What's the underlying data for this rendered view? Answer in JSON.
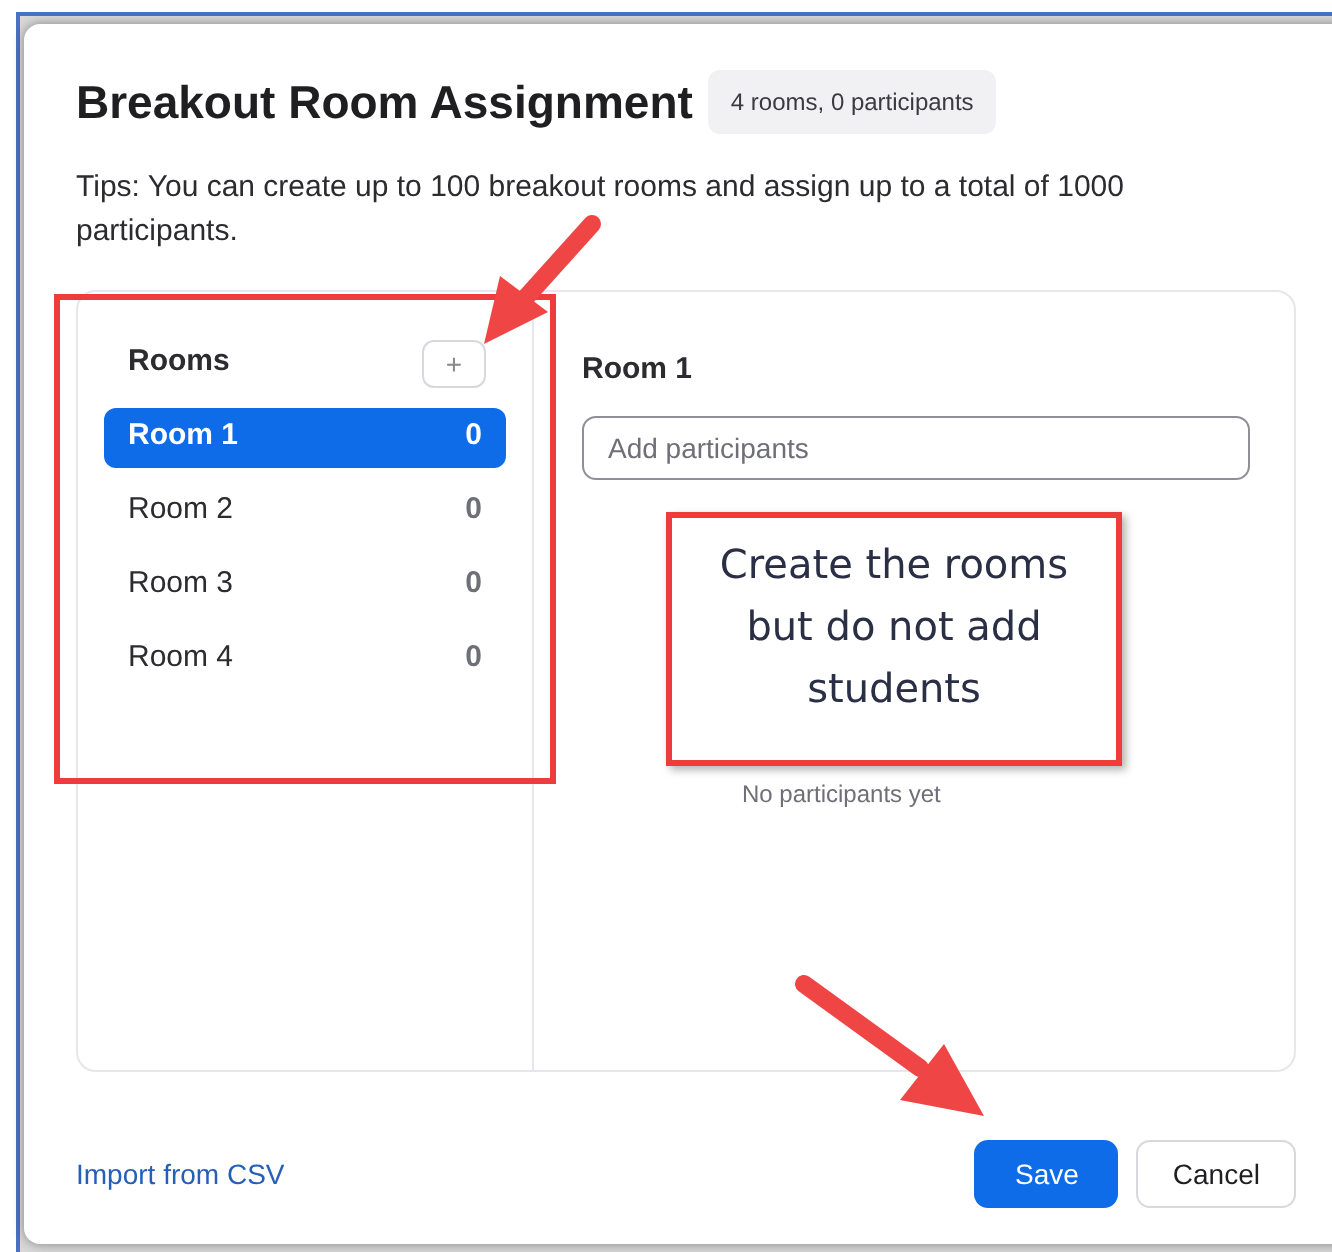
{
  "dialog": {
    "title": "Breakout Room Assignment",
    "summary": "4 rooms, 0 participants",
    "tips": "Tips: You can create up to 100 breakout rooms and assign up to a total of 1000 participants."
  },
  "rooms_panel": {
    "heading": "Rooms",
    "add_button": "+",
    "rooms": [
      {
        "name": "Room 1",
        "count": "0",
        "selected": true
      },
      {
        "name": "Room 2",
        "count": "0",
        "selected": false
      },
      {
        "name": "Room 3",
        "count": "0",
        "selected": false
      },
      {
        "name": "Room 4",
        "count": "0",
        "selected": false
      }
    ]
  },
  "room_detail": {
    "title": "Room 1",
    "search": {
      "placeholder": "Add participants"
    },
    "empty_message": "No participants yet"
  },
  "footer": {
    "import_link": "Import from CSV",
    "buttons": [
      {
        "label": "Save",
        "kind": "primary"
      },
      {
        "label": "Cancel",
        "kind": "secondary"
      }
    ]
  },
  "annotation": {
    "callout": "Create the rooms but do not add students"
  }
}
